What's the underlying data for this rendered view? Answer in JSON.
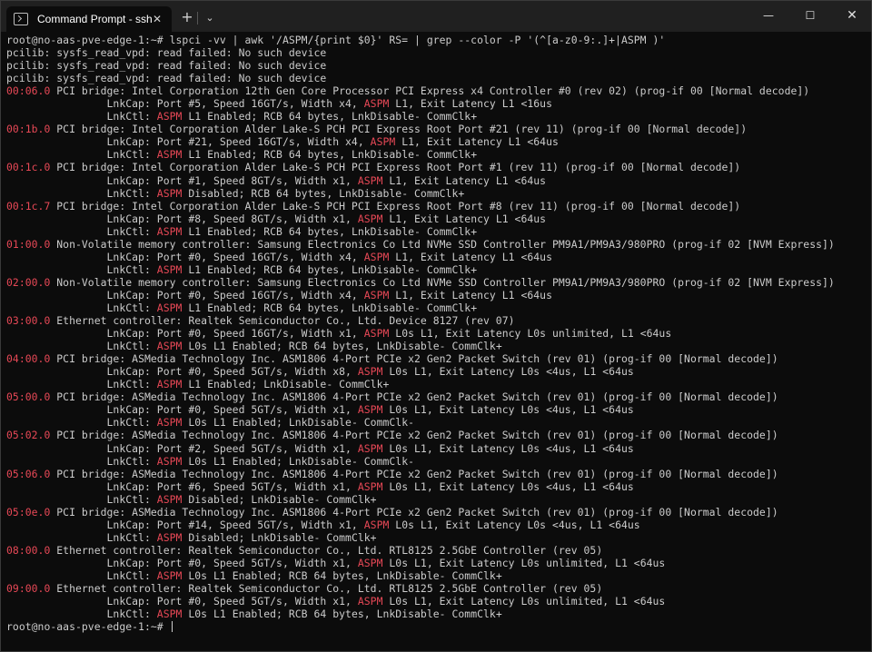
{
  "window": {
    "tab_title": "Command Prompt - ssh  root@",
    "tab_close_glyph": "✕",
    "new_tab_glyph": "+",
    "dropdown_glyph": "⌄",
    "minimize_glyph": "—",
    "maximize_glyph": "☐",
    "close_glyph": "✕"
  },
  "colors": {
    "background": "#0c0c0c",
    "text": "#cccccc",
    "highlight": "#e74856",
    "titlebar": "#202020"
  },
  "terminal": {
    "lines": [
      {
        "text": "root@no-aas-pve-edge-1:~# lspci -vv | awk '/ASPM/{print $0}' RS= | grep --color -P '(^[a-z0-9:.]+|ASPM )'"
      },
      {
        "text": "pcilib: sysfs_read_vpd: read failed: No such device"
      },
      {
        "text": "pcilib: sysfs_read_vpd: read failed: No such device"
      },
      {
        "text": "pcilib: sysfs_read_vpd: read failed: No such device"
      },
      {
        "addr": "00:06.0",
        "text": " PCI bridge: Intel Corporation 12th Gen Core Processor PCI Express x4 Controller #0 (rev 02) (prog-if 00 [Normal decode])"
      },
      {
        "pre": "                LnkCap: Port #5, Speed 16GT/s, Width x4, ",
        "aspm": "ASPM",
        "post": " L1, Exit Latency L1 <16us"
      },
      {
        "pre": "                LnkCtl: ",
        "aspm": "ASPM",
        "post": " L1 Enabled; RCB 64 bytes, LnkDisable- CommClk+"
      },
      {
        "addr": "00:1b.0",
        "text": " PCI bridge: Intel Corporation Alder Lake-S PCH PCI Express Root Port #21 (rev 11) (prog-if 00 [Normal decode])"
      },
      {
        "pre": "                LnkCap: Port #21, Speed 16GT/s, Width x4, ",
        "aspm": "ASPM",
        "post": " L1, Exit Latency L1 <64us"
      },
      {
        "pre": "                LnkCtl: ",
        "aspm": "ASPM",
        "post": " L1 Enabled; RCB 64 bytes, LnkDisable- CommClk+"
      },
      {
        "addr": "00:1c.0",
        "text": " PCI bridge: Intel Corporation Alder Lake-S PCH PCI Express Root Port #1 (rev 11) (prog-if 00 [Normal decode])"
      },
      {
        "pre": "                LnkCap: Port #1, Speed 8GT/s, Width x1, ",
        "aspm": "ASPM",
        "post": " L1, Exit Latency L1 <64us"
      },
      {
        "pre": "                LnkCtl: ",
        "aspm": "ASPM",
        "post": " Disabled; RCB 64 bytes, LnkDisable- CommClk+"
      },
      {
        "addr": "00:1c.7",
        "text": " PCI bridge: Intel Corporation Alder Lake-S PCH PCI Express Root Port #8 (rev 11) (prog-if 00 [Normal decode])"
      },
      {
        "pre": "                LnkCap: Port #8, Speed 8GT/s, Width x1, ",
        "aspm": "ASPM",
        "post": " L1, Exit Latency L1 <64us"
      },
      {
        "pre": "                LnkCtl: ",
        "aspm": "ASPM",
        "post": " L1 Enabled; RCB 64 bytes, LnkDisable- CommClk+"
      },
      {
        "addr": "01:00.0",
        "text": " Non-Volatile memory controller: Samsung Electronics Co Ltd NVMe SSD Controller PM9A1/PM9A3/980PRO (prog-if 02 [NVM Express])"
      },
      {
        "pre": "                LnkCap: Port #0, Speed 16GT/s, Width x4, ",
        "aspm": "ASPM",
        "post": " L1, Exit Latency L1 <64us"
      },
      {
        "pre": "                LnkCtl: ",
        "aspm": "ASPM",
        "post": " L1 Enabled; RCB 64 bytes, LnkDisable- CommClk+"
      },
      {
        "addr": "02:00.0",
        "text": " Non-Volatile memory controller: Samsung Electronics Co Ltd NVMe SSD Controller PM9A1/PM9A3/980PRO (prog-if 02 [NVM Express])"
      },
      {
        "pre": "                LnkCap: Port #0, Speed 16GT/s, Width x4, ",
        "aspm": "ASPM",
        "post": " L1, Exit Latency L1 <64us"
      },
      {
        "pre": "                LnkCtl: ",
        "aspm": "ASPM",
        "post": " L1 Enabled; RCB 64 bytes, LnkDisable- CommClk+"
      },
      {
        "addr": "03:00.0",
        "text": " Ethernet controller: Realtek Semiconductor Co., Ltd. Device 8127 (rev 07)"
      },
      {
        "pre": "                LnkCap: Port #0, Speed 16GT/s, Width x1, ",
        "aspm": "ASPM",
        "post": " L0s L1, Exit Latency L0s unlimited, L1 <64us"
      },
      {
        "pre": "                LnkCtl: ",
        "aspm": "ASPM",
        "post": " L0s L1 Enabled; RCB 64 bytes, LnkDisable- CommClk+"
      },
      {
        "addr": "04:00.0",
        "text": " PCI bridge: ASMedia Technology Inc. ASM1806 4-Port PCIe x2 Gen2 Packet Switch (rev 01) (prog-if 00 [Normal decode])"
      },
      {
        "pre": "                LnkCap: Port #0, Speed 5GT/s, Width x8, ",
        "aspm": "ASPM",
        "post": " L0s L1, Exit Latency L0s <4us, L1 <64us"
      },
      {
        "pre": "                LnkCtl: ",
        "aspm": "ASPM",
        "post": " L1 Enabled; LnkDisable- CommClk+"
      },
      {
        "addr": "05:00.0",
        "text": " PCI bridge: ASMedia Technology Inc. ASM1806 4-Port PCIe x2 Gen2 Packet Switch (rev 01) (prog-if 00 [Normal decode])"
      },
      {
        "pre": "                LnkCap: Port #0, Speed 5GT/s, Width x1, ",
        "aspm": "ASPM",
        "post": " L0s L1, Exit Latency L0s <4us, L1 <64us"
      },
      {
        "pre": "                LnkCtl: ",
        "aspm": "ASPM",
        "post": " L0s L1 Enabled; LnkDisable- CommClk-"
      },
      {
        "addr": "05:02.0",
        "text": " PCI bridge: ASMedia Technology Inc. ASM1806 4-Port PCIe x2 Gen2 Packet Switch (rev 01) (prog-if 00 [Normal decode])"
      },
      {
        "pre": "                LnkCap: Port #2, Speed 5GT/s, Width x1, ",
        "aspm": "ASPM",
        "post": " L0s L1, Exit Latency L0s <4us, L1 <64us"
      },
      {
        "pre": "                LnkCtl: ",
        "aspm": "ASPM",
        "post": " L0s L1 Enabled; LnkDisable- CommClk-"
      },
      {
        "addr": "05:06.0",
        "text": " PCI bridge: ASMedia Technology Inc. ASM1806 4-Port PCIe x2 Gen2 Packet Switch (rev 01) (prog-if 00 [Normal decode])"
      },
      {
        "pre": "                LnkCap: Port #6, Speed 5GT/s, Width x1, ",
        "aspm": "ASPM",
        "post": " L0s L1, Exit Latency L0s <4us, L1 <64us"
      },
      {
        "pre": "                LnkCtl: ",
        "aspm": "ASPM",
        "post": " Disabled; LnkDisable- CommClk+"
      },
      {
        "addr": "05:0e.0",
        "text": " PCI bridge: ASMedia Technology Inc. ASM1806 4-Port PCIe x2 Gen2 Packet Switch (rev 01) (prog-if 00 [Normal decode])"
      },
      {
        "pre": "                LnkCap: Port #14, Speed 5GT/s, Width x1, ",
        "aspm": "ASPM",
        "post": " L0s L1, Exit Latency L0s <4us, L1 <64us"
      },
      {
        "pre": "                LnkCtl: ",
        "aspm": "ASPM",
        "post": " Disabled; LnkDisable- CommClk+"
      },
      {
        "addr": "08:00.0",
        "text": " Ethernet controller: Realtek Semiconductor Co., Ltd. RTL8125 2.5GbE Controller (rev 05)"
      },
      {
        "pre": "                LnkCap: Port #0, Speed 5GT/s, Width x1, ",
        "aspm": "ASPM",
        "post": " L0s L1, Exit Latency L0s unlimited, L1 <64us"
      },
      {
        "pre": "                LnkCtl: ",
        "aspm": "ASPM",
        "post": " L0s L1 Enabled; RCB 64 bytes, LnkDisable- CommClk+"
      },
      {
        "addr": "09:00.0",
        "text": " Ethernet controller: Realtek Semiconductor Co., Ltd. RTL8125 2.5GbE Controller (rev 05)"
      },
      {
        "pre": "                LnkCap: Port #0, Speed 5GT/s, Width x1, ",
        "aspm": "ASPM",
        "post": " L0s L1, Exit Latency L0s unlimited, L1 <64us"
      },
      {
        "pre": "                LnkCtl: ",
        "aspm": "ASPM",
        "post": " L0s L1 Enabled; RCB 64 bytes, LnkDisable- CommClk+"
      }
    ],
    "prompt": "root@no-aas-pve-edge-1:~# "
  }
}
